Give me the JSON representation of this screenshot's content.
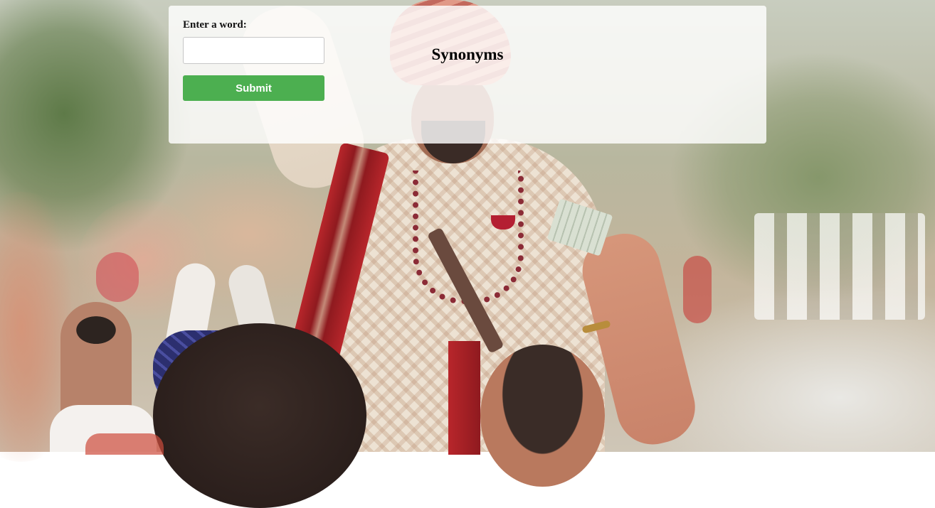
{
  "form": {
    "word_label": "Enter a word:",
    "word_value": "",
    "word_placeholder": "",
    "submit_label": "Submit"
  },
  "results": {
    "title": "Synonyms"
  },
  "colors": {
    "submit_button": "#4caf50",
    "panel_background": "#ffffff"
  }
}
